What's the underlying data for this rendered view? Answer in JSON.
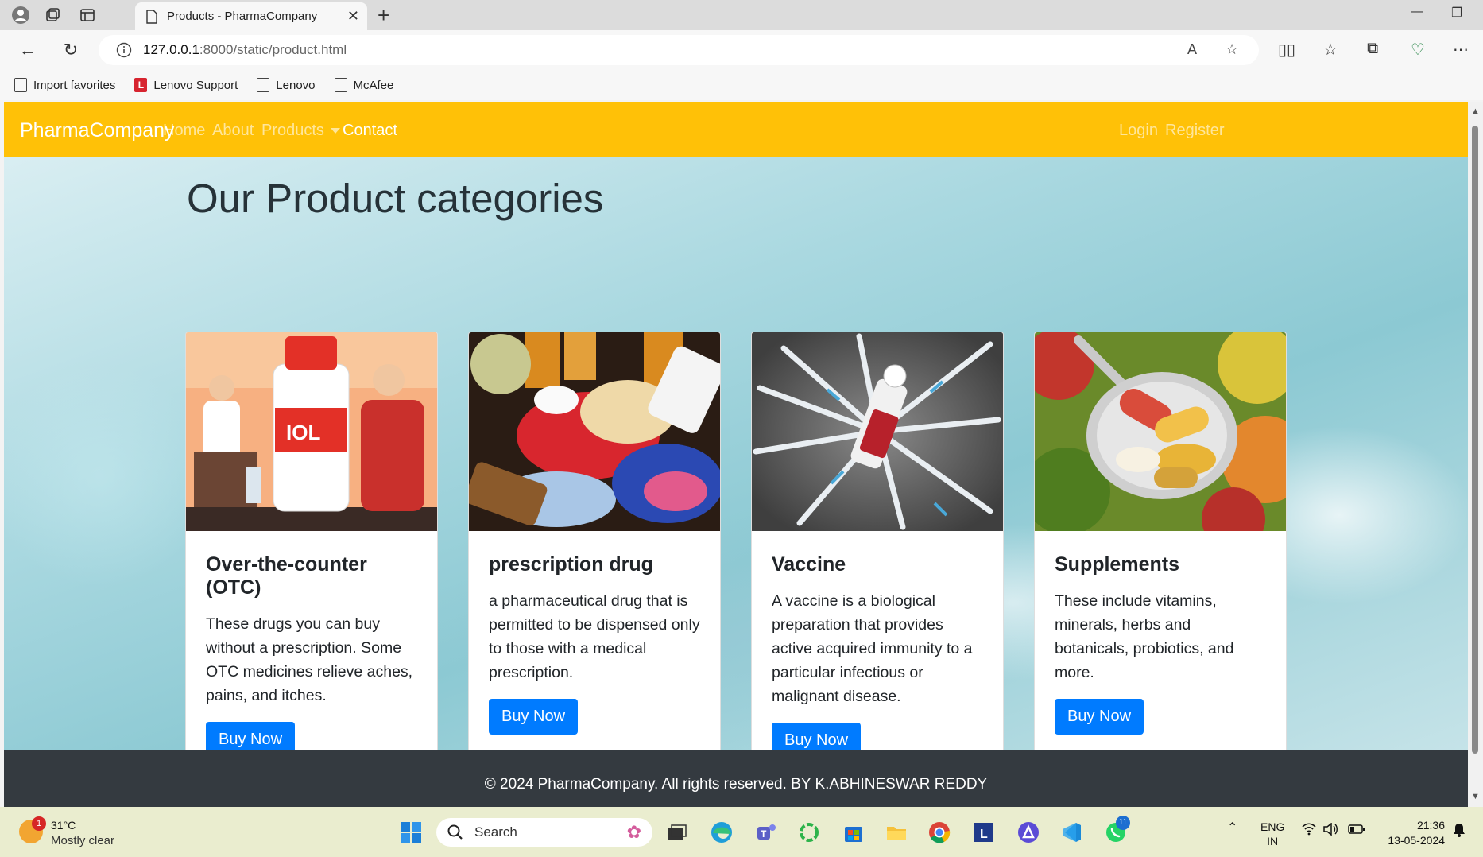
{
  "browser": {
    "tab_title": "Products - PharmaCompany",
    "url_host": "127.0.0.1",
    "url_path": ":8000/static/product.html",
    "favorites": [
      "Import favorites",
      "Lenovo Support",
      "Lenovo",
      "McAfee"
    ]
  },
  "navbar": {
    "brand": "PharmaCompany",
    "links": [
      "Home",
      "About",
      "Products",
      "Contact"
    ],
    "right_links": [
      "Login",
      "Register"
    ],
    "bg_color": "#ffc107"
  },
  "hero": {
    "title": "Our Product categories"
  },
  "cards": [
    {
      "title": "Over-the-counter (OTC)",
      "text": "These drugs you can buy without a prescription. Some OTC medicines relieve aches, pains, and itches.",
      "button": "Buy Now"
    },
    {
      "title": "prescription drug",
      "text": "a pharmaceutical drug that is permitted to be dispensed only to those with a medical prescription.",
      "button": "Buy Now"
    },
    {
      "title": "Vaccine",
      "text": "A vaccine is a biological preparation that provides active acquired immunity to a particular infectious or malignant disease.",
      "button": "Buy Now"
    },
    {
      "title": "Supplements",
      "text": "These include vitamins, minerals, herbs and botanicals, probiotics, and more.",
      "button": "Buy Now"
    }
  ],
  "footer": {
    "text": "© 2024 PharmaCompany. All rights reserved. BY K.ABHINESWAR REDDY"
  },
  "taskbar": {
    "weather_temp": "31°C",
    "weather_desc": "Mostly clear",
    "weather_badge": "1",
    "search_label": "Search",
    "lang": "ENG",
    "region": "IN",
    "time": "21:36",
    "date": "13-05-2024",
    "whatsapp_badge": "11"
  },
  "colors": {
    "primary_button": "#007bff",
    "footer_bg": "#343a40"
  }
}
